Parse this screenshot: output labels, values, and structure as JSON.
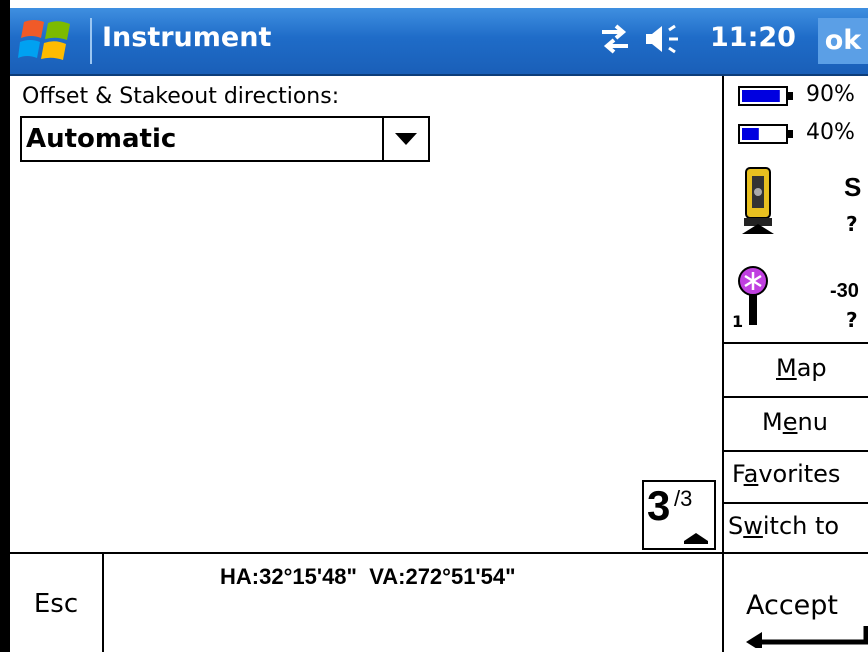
{
  "titlebar": {
    "title": "Instrument",
    "time": "11:20",
    "ok_label": "ok",
    "icons": [
      "windows-logo-icon",
      "connectivity-icon",
      "speaker-icon"
    ]
  },
  "main": {
    "field_label": "Offset & Stakeout directions:",
    "dropdown_value": "Automatic",
    "pager": {
      "current": "3",
      "total": "/3"
    }
  },
  "sidebar": {
    "battery1_text": "90%",
    "battery1_level": 0.9,
    "battery2_text": "40%",
    "battery2_level": 0.4,
    "instrument_status": "S",
    "instrument_q": "?",
    "target_value": "-30",
    "target_q": "?",
    "target_number": "1",
    "buttons": {
      "map": {
        "pre": "",
        "u": "M",
        "post": "ap"
      },
      "menu": {
        "pre": "M",
        "u": "e",
        "post": "nu"
      },
      "favorites": {
        "pre": "F",
        "u": "a",
        "post": "vorites"
      },
      "switch": {
        "pre": "S",
        "u": "w",
        "post": "itch to"
      }
    }
  },
  "bottom": {
    "esc_label": "Esc",
    "readout": "HA:32°15'48\"  VA:272°51'54\"",
    "accept_label": "Accept"
  },
  "colors": {
    "titlebar": "#1f6cc8",
    "battery_fill": "#0000e0",
    "target_magenta": "#c040e0",
    "instrument_yellow": "#e8c020"
  }
}
